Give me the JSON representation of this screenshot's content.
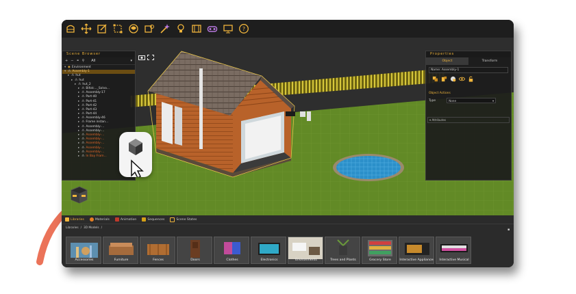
{
  "toolbar": {
    "icons": [
      "pencil-shape-icon",
      "move-arrows-icon",
      "edit-square-icon",
      "select-box-icon",
      "globe-paint-icon",
      "cube-gear-icon",
      "wand-icon",
      "light-bulb-icon",
      "film-icon",
      "vr-goggles-icon",
      "monitor-icon",
      "help-icon"
    ]
  },
  "scene_browser": {
    "title": "Scene Browser",
    "filter": "All",
    "items": [
      {
        "label": "Environment",
        "indent": 0,
        "state": "normal"
      },
      {
        "label": "Assembly-1",
        "indent": 0,
        "state": "active"
      },
      {
        "label": "hut",
        "indent": 1,
        "state": "normal"
      },
      {
        "label": "hut",
        "indent": 2,
        "state": "normal"
      },
      {
        "label": "hut_2",
        "indent": 3,
        "state": "normal"
      },
      {
        "label": "Bifolc..._Solva...",
        "indent": 4,
        "state": "normal"
      },
      {
        "label": "Assembly-17",
        "indent": 4,
        "state": "normal"
      },
      {
        "label": "Part-40",
        "indent": 4,
        "state": "normal"
      },
      {
        "label": "Part-41",
        "indent": 4,
        "state": "normal"
      },
      {
        "label": "Part-42",
        "indent": 4,
        "state": "normal"
      },
      {
        "label": "Part-43",
        "indent": 4,
        "state": "normal"
      },
      {
        "label": "Part-44",
        "indent": 4,
        "state": "normal"
      },
      {
        "label": "Assembly-46",
        "indent": 4,
        "state": "normal"
      },
      {
        "label": "Frame instan...",
        "indent": 4,
        "state": "normal"
      },
      {
        "label": "Assembly-...",
        "indent": 4,
        "state": "normal"
      },
      {
        "label": "Assembly-...",
        "indent": 4,
        "state": "normal"
      },
      {
        "label": "Assembly-...",
        "indent": 4,
        "state": "orange"
      },
      {
        "label": "Assembly-...",
        "indent": 4,
        "state": "orange"
      },
      {
        "label": "Assembly-...",
        "indent": 4,
        "state": "orange"
      },
      {
        "label": "Assembly-...",
        "indent": 4,
        "state": "orange"
      },
      {
        "label": "Assembly-...",
        "indent": 4,
        "state": "orange"
      },
      {
        "label": "In Bay Fram...",
        "indent": 4,
        "state": "orange"
      }
    ]
  },
  "properties": {
    "title": "Properties",
    "tabs": [
      "Object",
      "Transform"
    ],
    "name_label": "Name:",
    "name_value": "Assembly-1",
    "section_actions": "Object Actions",
    "type_label": "Type",
    "type_value": "None",
    "attributes": "Attributes"
  },
  "bottom": {
    "tabs": [
      "Libraries",
      "Materials",
      "Animation",
      "Sequences",
      "Scene States"
    ],
    "breadcrumb": [
      "Libraries",
      "3D Models"
    ],
    "categories": [
      "Accessories",
      "Furniture",
      "Fences",
      "Doors",
      "Clothes",
      "Electronics",
      "Environments",
      "Trees and Plants",
      "Grocery Store",
      "Interactive Appliances",
      "Interactive Musical"
    ]
  },
  "colors": {
    "accent": "#f2b63c",
    "grass": "#6b8a2a",
    "panel": "#1c1c1c",
    "orange_highlight": "#e2662a"
  }
}
